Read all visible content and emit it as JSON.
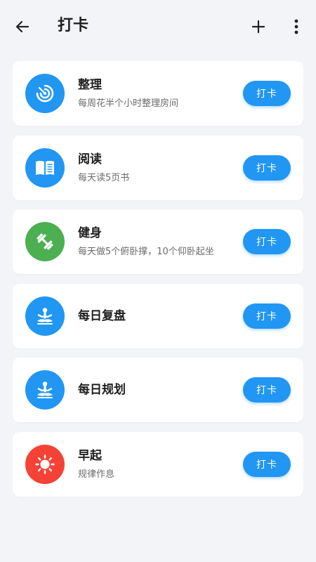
{
  "appbar": {
    "title": "打卡",
    "back_icon": "arrow-back-icon",
    "add_icon": "plus-icon",
    "more_icon": "more-vertical-icon"
  },
  "colors": {
    "accent": "#2196F3",
    "green": "#4CAF50",
    "red": "#F44336",
    "background": "#F3F4F8"
  },
  "habits": [
    {
      "name": "整理",
      "desc": "每周花半个小时整理房间",
      "icon": "target-icon",
      "color": "#2196F3",
      "button": "打卡"
    },
    {
      "name": "阅读",
      "desc": "每天读5页书",
      "icon": "book-icon",
      "color": "#2196F3",
      "button": "打卡"
    },
    {
      "name": "健身",
      "desc": "每天做5个俯卧撑，10个仰卧起坐",
      "icon": "dumbbell-icon",
      "color": "#4CAF50",
      "button": "打卡"
    },
    {
      "name": "每日复盘",
      "desc": "",
      "icon": "meditation-icon",
      "color": "#2196F3",
      "button": "打卡"
    },
    {
      "name": "每日规划",
      "desc": "",
      "icon": "meditation-icon",
      "color": "#2196F3",
      "button": "打卡"
    },
    {
      "name": "早起",
      "desc": "规律作息",
      "icon": "sun-icon",
      "color": "#F44336",
      "button": "打卡"
    }
  ]
}
